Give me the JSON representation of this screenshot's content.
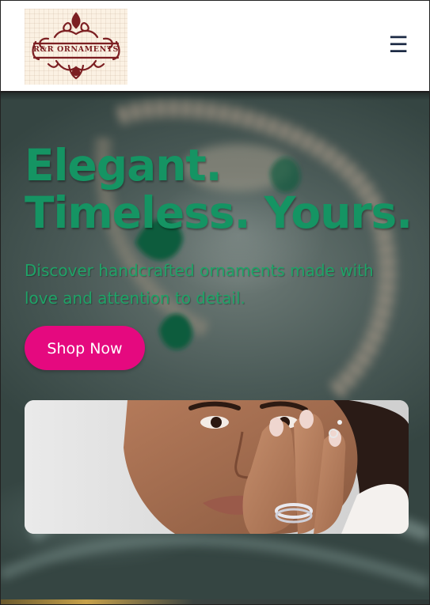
{
  "header": {
    "logo_text": "R&R ORNAMENTS",
    "menu_icon": "hamburger-menu-icon",
    "menu_glyph": "☰"
  },
  "hero": {
    "title_line1": "Elegant.",
    "title_line2": "Timeless. Yours.",
    "subtitle": "Discover handcrafted ornaments made with love and attention to detail.",
    "cta_label": "Shop Now"
  },
  "colors": {
    "brand_green": "#159463",
    "cta_pink": "#e5097f",
    "logo_maroon": "#7c1f22",
    "hero_bg": "#4a5a57"
  }
}
